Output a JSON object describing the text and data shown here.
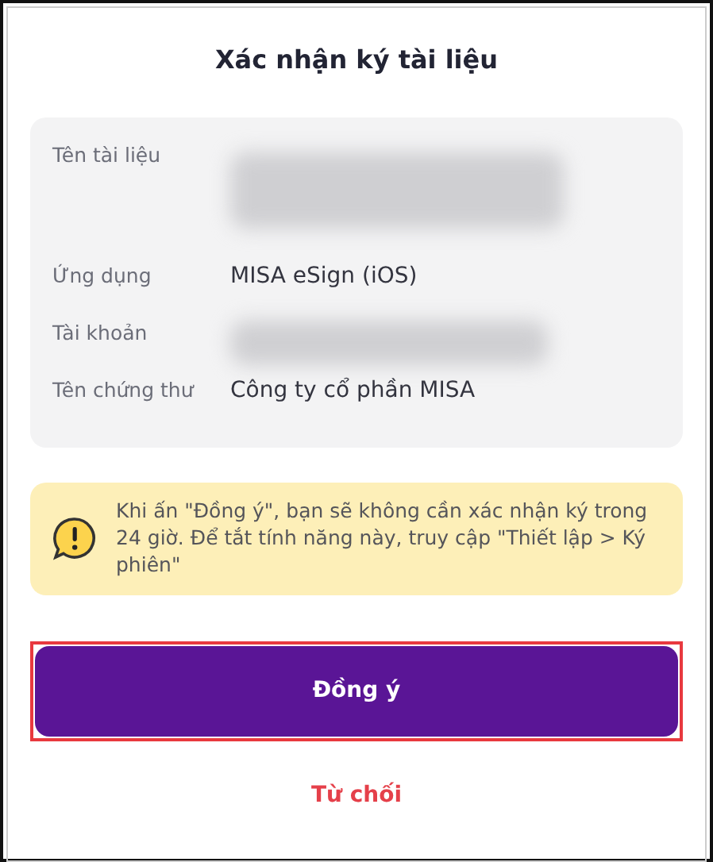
{
  "title": "Xác nhận ký tài liệu",
  "details": [
    {
      "label": "Tên tài liệu",
      "kind": "redacted"
    },
    {
      "label": "Ứng dụng",
      "kind": "text",
      "value": "MISA eSign (iOS)"
    },
    {
      "label": "Tài khoản",
      "kind": "redacted"
    },
    {
      "label": "Tên chứng thư",
      "kind": "text",
      "value": "Công ty cổ phần MISA"
    }
  ],
  "notice": "Khi ấn \"Đồng ý\", bạn sẽ không cần xác nhận ký trong 24 giờ. Để tắt tính năng này, truy cập \"Thiết lập > Ký phiên\"",
  "confirm_button": {
    "label": "Đồng ý",
    "highlighted": true
  },
  "reject_button": {
    "label": "Từ chối"
  }
}
